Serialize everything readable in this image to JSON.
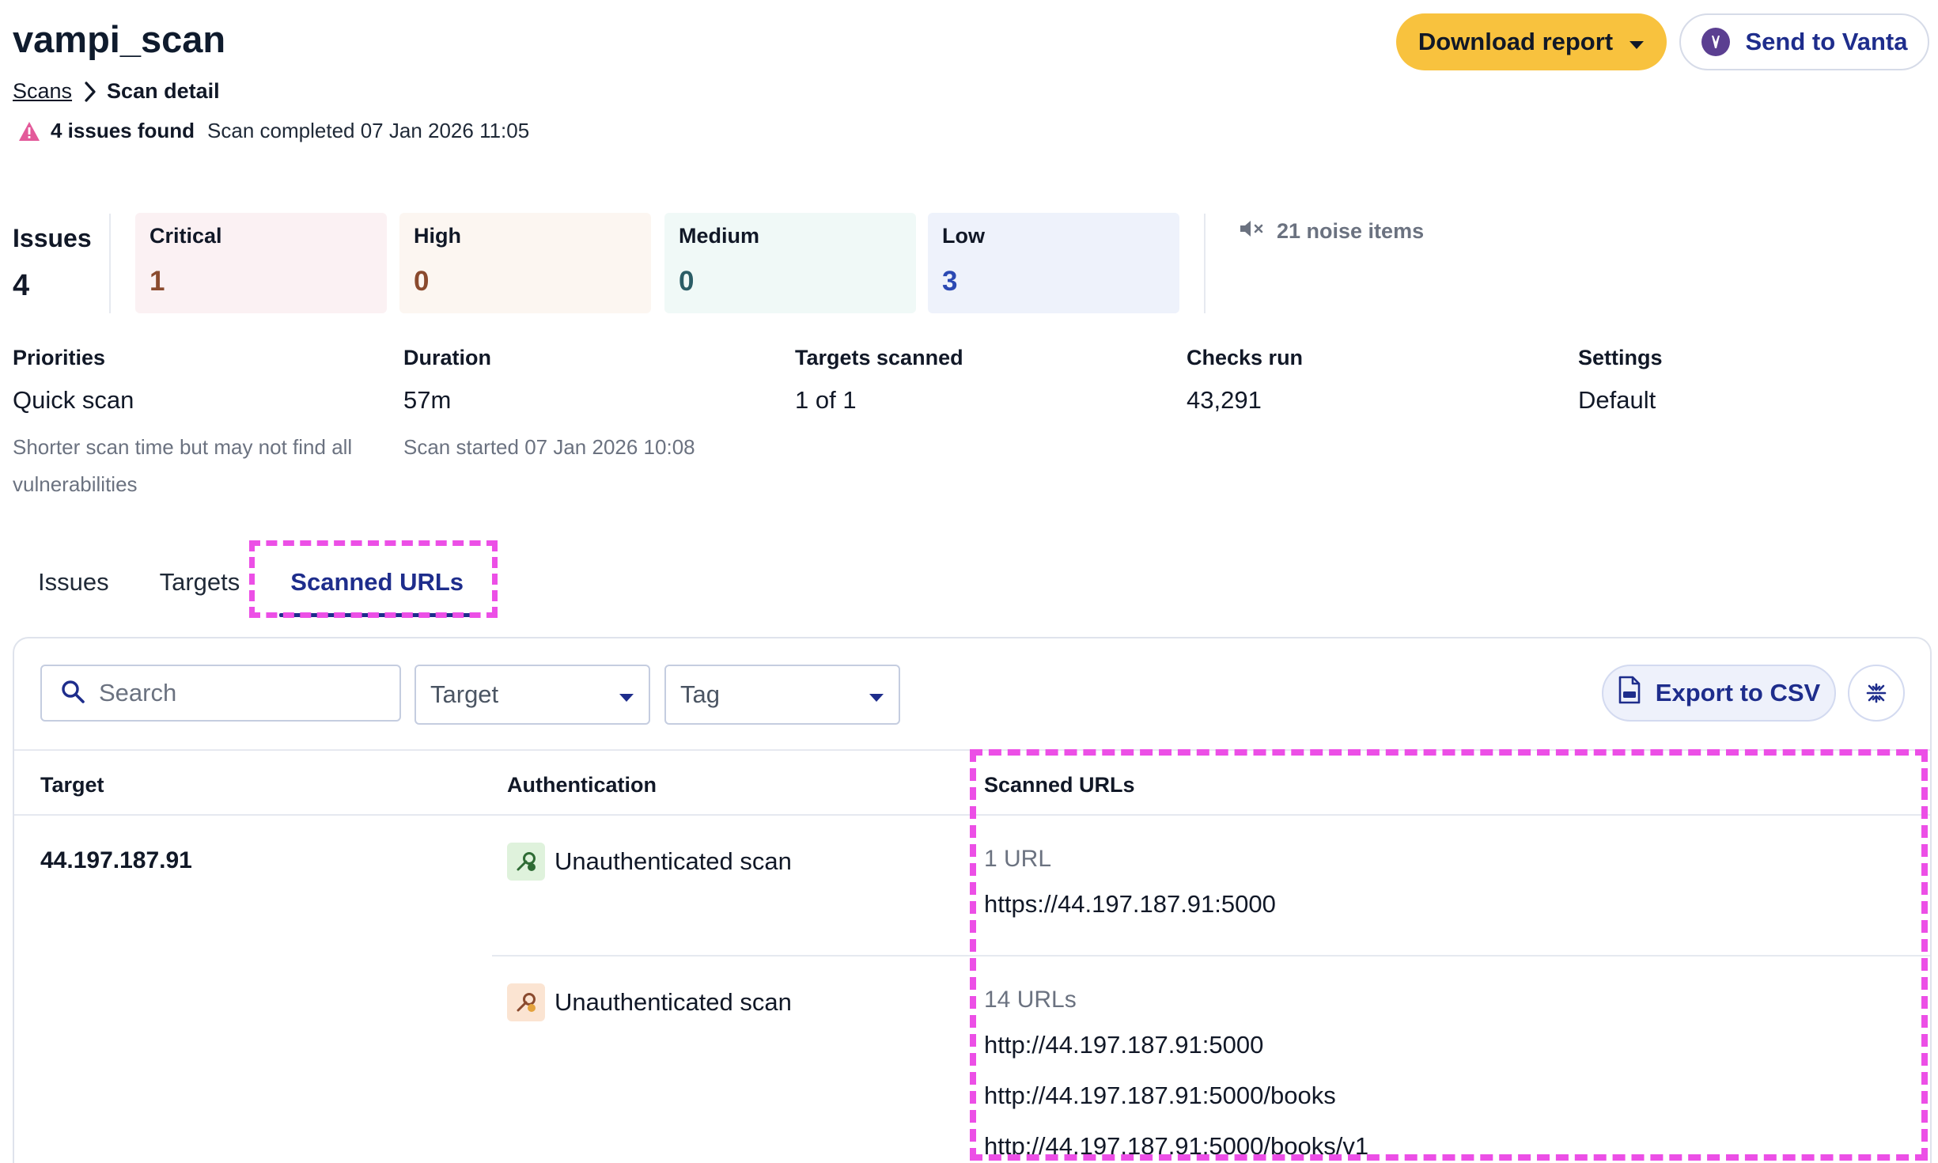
{
  "header": {
    "title": "vampi_scan",
    "breadcrumb": {
      "parent": "Scans",
      "current": "Scan detail"
    },
    "issues_found": "4 issues found",
    "completed": "Scan completed 07 Jan 2026 11:05",
    "download_label": "Download report",
    "vanta_label": "Send to Vanta"
  },
  "summary": {
    "issues_label": "Issues",
    "issues_total": "4",
    "critical": {
      "label": "Critical",
      "count": "1"
    },
    "high": {
      "label": "High",
      "count": "0"
    },
    "medium": {
      "label": "Medium",
      "count": "0"
    },
    "low": {
      "label": "Low",
      "count": "3"
    },
    "noise": "21 noise items"
  },
  "meta": {
    "priorities": {
      "label": "Priorities",
      "value": "Quick scan",
      "sub": "Shorter scan time but may not find all vulnerabilities"
    },
    "duration": {
      "label": "Duration",
      "value": "57m",
      "sub": "Scan started 07 Jan 2026 10:08"
    },
    "targets": {
      "label": "Targets scanned",
      "value": "1 of 1"
    },
    "checks": {
      "label": "Checks run",
      "value": "43,291"
    },
    "settings": {
      "label": "Settings",
      "value": "Default"
    }
  },
  "tabs": [
    {
      "label": "Issues"
    },
    {
      "label": "Targets"
    },
    {
      "label": "Scanned URLs",
      "active": true
    }
  ],
  "toolbar": {
    "search_placeholder": "Search",
    "target_filter": "Target",
    "tag_filter": "Tag",
    "export_label": "Export to CSV"
  },
  "table": {
    "columns": [
      "Target",
      "Authentication",
      "Scanned URLs"
    ],
    "target": "44.197.187.91",
    "rows": [
      {
        "auth": "Unauthenticated scan",
        "count": "1 URL",
        "urls": [
          "https://44.197.187.91:5000"
        ]
      },
      {
        "auth": "Unauthenticated scan",
        "count": "14 URLs",
        "urls": [
          "http://44.197.187.91:5000",
          "http://44.197.187.91:5000/books",
          "http://44.197.187.91:5000/books/v1"
        ]
      }
    ]
  },
  "colors": {
    "accent": "#1e2d8c",
    "download_button": "#f8c23e",
    "highlight": "#ec4fe6"
  }
}
